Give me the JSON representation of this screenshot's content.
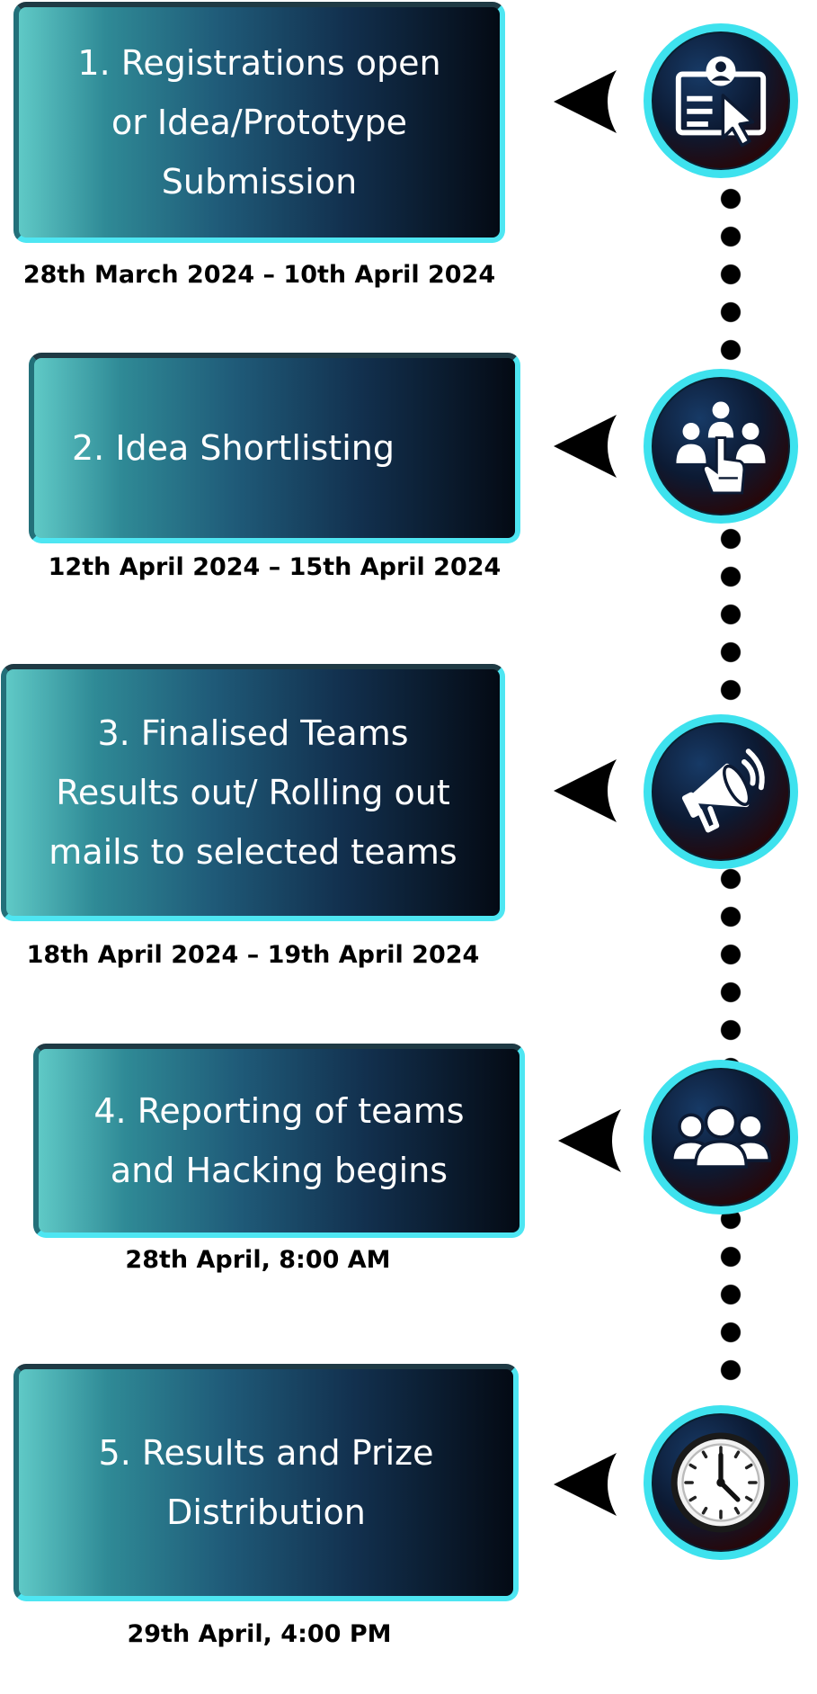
{
  "steps": [
    {
      "title": "1. Registrations open\nor Idea/Prototype\nSubmission",
      "date": "28th March 2024 – 10th April 2024",
      "icon": "registration-icon"
    },
    {
      "title": "2. Idea Shortlisting",
      "date": "12th April 2024 – 15th April 2024",
      "icon": "shortlist-icon"
    },
    {
      "title": "3. Finalised Teams\nResults out/ Rolling out\nmails to selected teams",
      "date": "18th April 2024 – 19th April 2024",
      "icon": "megaphone-icon"
    },
    {
      "title": "4. Reporting of teams\nand Hacking begins",
      "date": "28th April, 8:00 AM",
      "icon": "team-icon"
    },
    {
      "title": "5. Results and Prize\nDistribution",
      "date": "29th April, 4:00 PM",
      "icon": "clock-icon"
    }
  ],
  "colors": {
    "accent": "#4ee6f2",
    "box_dark": "#040a14",
    "box_light": "#5fc9c6"
  }
}
